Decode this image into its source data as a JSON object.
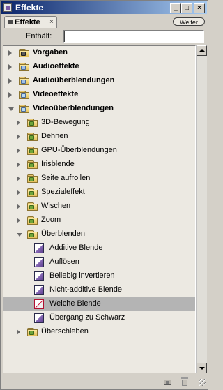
{
  "window": {
    "title": "Effekte",
    "controls": {
      "minimize": "_",
      "maximize": "□",
      "close": "×"
    }
  },
  "tabbar": {
    "tab_label": "Effekte",
    "tab_close": "×",
    "weiter_label": "Weiter"
  },
  "search": {
    "label": "Enthält:",
    "value": "",
    "placeholder": ""
  },
  "tree": [
    {
      "label": "Vorgaben",
      "bold": true,
      "level": 0,
      "expanded": false,
      "kind": "folder",
      "icon": "star"
    },
    {
      "label": "Audioeffekte",
      "bold": true,
      "level": 0,
      "expanded": false,
      "kind": "folder",
      "icon": "audio"
    },
    {
      "label": "Audioüberblendungen",
      "bold": true,
      "level": 0,
      "expanded": false,
      "kind": "folder",
      "icon": "audio"
    },
    {
      "label": "Videoeffekte",
      "bold": true,
      "level": 0,
      "expanded": false,
      "kind": "folder",
      "icon": "video"
    },
    {
      "label": "Videoüberblendungen",
      "bold": true,
      "level": 0,
      "expanded": true,
      "kind": "folder",
      "icon": "video"
    },
    {
      "label": "3D-Bewegung",
      "bold": false,
      "level": 1,
      "expanded": false,
      "kind": "folder",
      "icon": "bin"
    },
    {
      "label": "Dehnen",
      "bold": false,
      "level": 1,
      "expanded": false,
      "kind": "folder",
      "icon": "bin"
    },
    {
      "label": "GPU-Überblendungen",
      "bold": false,
      "level": 1,
      "expanded": false,
      "kind": "folder",
      "icon": "bin"
    },
    {
      "label": "Irisblende",
      "bold": false,
      "level": 1,
      "expanded": false,
      "kind": "folder",
      "icon": "bin"
    },
    {
      "label": "Seite aufrollen",
      "bold": false,
      "level": 1,
      "expanded": false,
      "kind": "folder",
      "icon": "bin"
    },
    {
      "label": "Spezialeffekt",
      "bold": false,
      "level": 1,
      "expanded": false,
      "kind": "folder",
      "icon": "bin"
    },
    {
      "label": "Wischen",
      "bold": false,
      "level": 1,
      "expanded": false,
      "kind": "folder",
      "icon": "bin"
    },
    {
      "label": "Zoom",
      "bold": false,
      "level": 1,
      "expanded": false,
      "kind": "folder",
      "icon": "bin"
    },
    {
      "label": "Überblenden",
      "bold": false,
      "level": 1,
      "expanded": true,
      "kind": "folder",
      "icon": "bin"
    },
    {
      "label": "Additive Blende",
      "bold": false,
      "level": 2,
      "kind": "effect",
      "icon": "transition"
    },
    {
      "label": "Auflösen",
      "bold": false,
      "level": 2,
      "kind": "effect",
      "icon": "transition"
    },
    {
      "label": "Beliebig invertieren",
      "bold": false,
      "level": 2,
      "kind": "effect",
      "icon": "transition"
    },
    {
      "label": "Nicht-additive Blende",
      "bold": false,
      "level": 2,
      "kind": "effect",
      "icon": "transition"
    },
    {
      "label": "Weiche Blende",
      "bold": false,
      "level": 2,
      "kind": "effect",
      "icon": "transition-default",
      "selected": true
    },
    {
      "label": "Übergang zu Schwarz",
      "bold": false,
      "level": 2,
      "kind": "effect",
      "icon": "transition"
    },
    {
      "label": "Überschieben",
      "bold": false,
      "level": 1,
      "expanded": false,
      "kind": "folder",
      "icon": "bin"
    }
  ],
  "colors": {
    "panel_bg": "#d4d0c8",
    "list_bg": "#ece9e2",
    "selected_row": "#b4b4b4",
    "title_gradient_start": "#0a246a",
    "title_gradient_end": "#a6caf0",
    "effect_icon": "#5d3e8e",
    "default_effect_icon": "#d02040"
  },
  "bottombar": {
    "new_bin_icon": "new-bin-icon",
    "delete_icon": "trash-icon"
  }
}
